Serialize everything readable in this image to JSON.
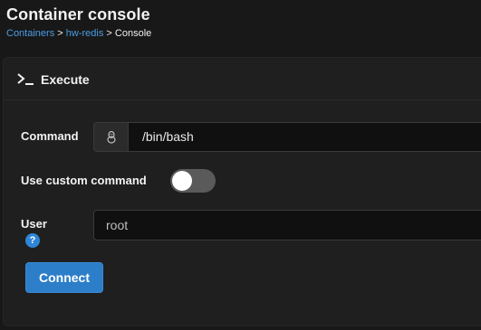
{
  "header": {
    "title": "Container console",
    "breadcrumb": [
      {
        "label": "Containers",
        "link": true
      },
      {
        "label": "hw-redis",
        "link": true
      },
      {
        "label": "Console",
        "link": false
      }
    ],
    "separator": ">"
  },
  "panel": {
    "icon": "terminal-icon",
    "title": "Execute"
  },
  "form": {
    "command_label": "Command",
    "command_icon": "linux-tux-icon",
    "command_value": "/bin/bash",
    "custom_command_label": "Use custom command",
    "custom_command_enabled": false,
    "user_label": "User",
    "user_help_icon": "question-circle-icon",
    "user_value": "root",
    "connect_label": "Connect"
  },
  "colors": {
    "background": "#181818",
    "panel": "#1f1f1f",
    "link": "#4a9ee6",
    "primary_button": "#2d7ec9",
    "help_icon": "#2f86d8"
  }
}
